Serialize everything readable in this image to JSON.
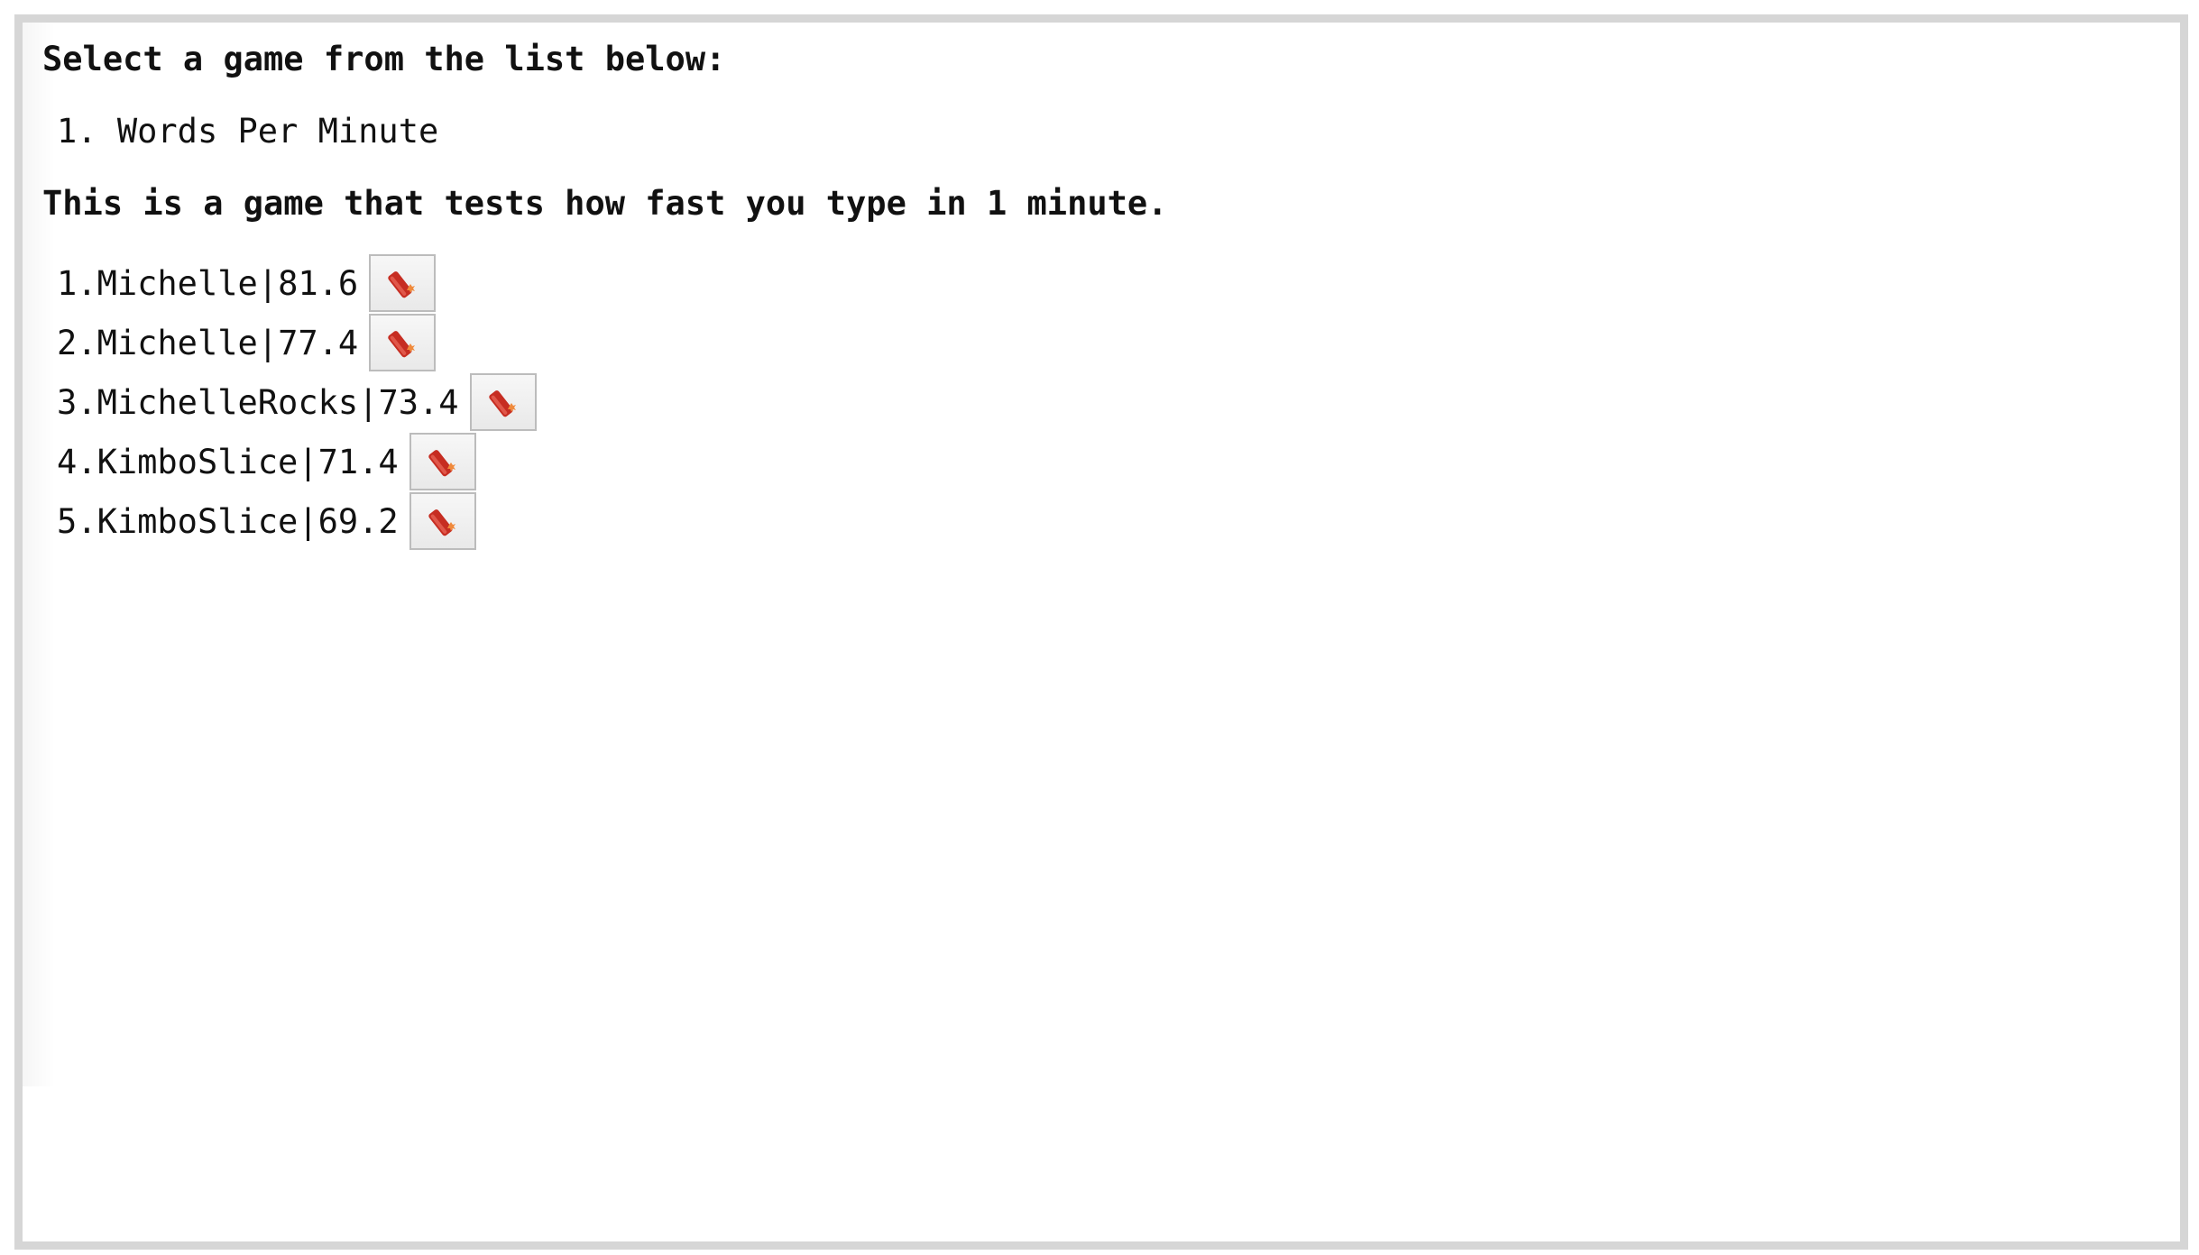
{
  "heading": "Select a game from the list below:",
  "games": [
    {
      "number": "1.",
      "name": "Words Per Minute"
    }
  ],
  "description": "This is a game that tests how fast you type in 1 minute.",
  "scores": [
    {
      "rank": "1.",
      "name": "Michelle",
      "separator": "|",
      "score": "81.6",
      "delete_icon": "dynamite-icon"
    },
    {
      "rank": "2.",
      "name": "Michelle",
      "separator": "|",
      "score": "77.4",
      "delete_icon": "dynamite-icon"
    },
    {
      "rank": "3.",
      "name": "MichelleRocks",
      "separator": "|",
      "score": "73.4",
      "delete_icon": "dynamite-icon"
    },
    {
      "rank": "4.",
      "name": "KimboSlice",
      "separator": "|",
      "score": "71.4",
      "delete_icon": "dynamite-icon"
    },
    {
      "rank": "5.",
      "name": "KimboSlice",
      "separator": "|",
      "score": "69.2",
      "delete_icon": "dynamite-icon"
    }
  ],
  "colors": {
    "frame_border": "#d6d6d6",
    "text": "#111111",
    "icon_red": "#c62d22"
  }
}
